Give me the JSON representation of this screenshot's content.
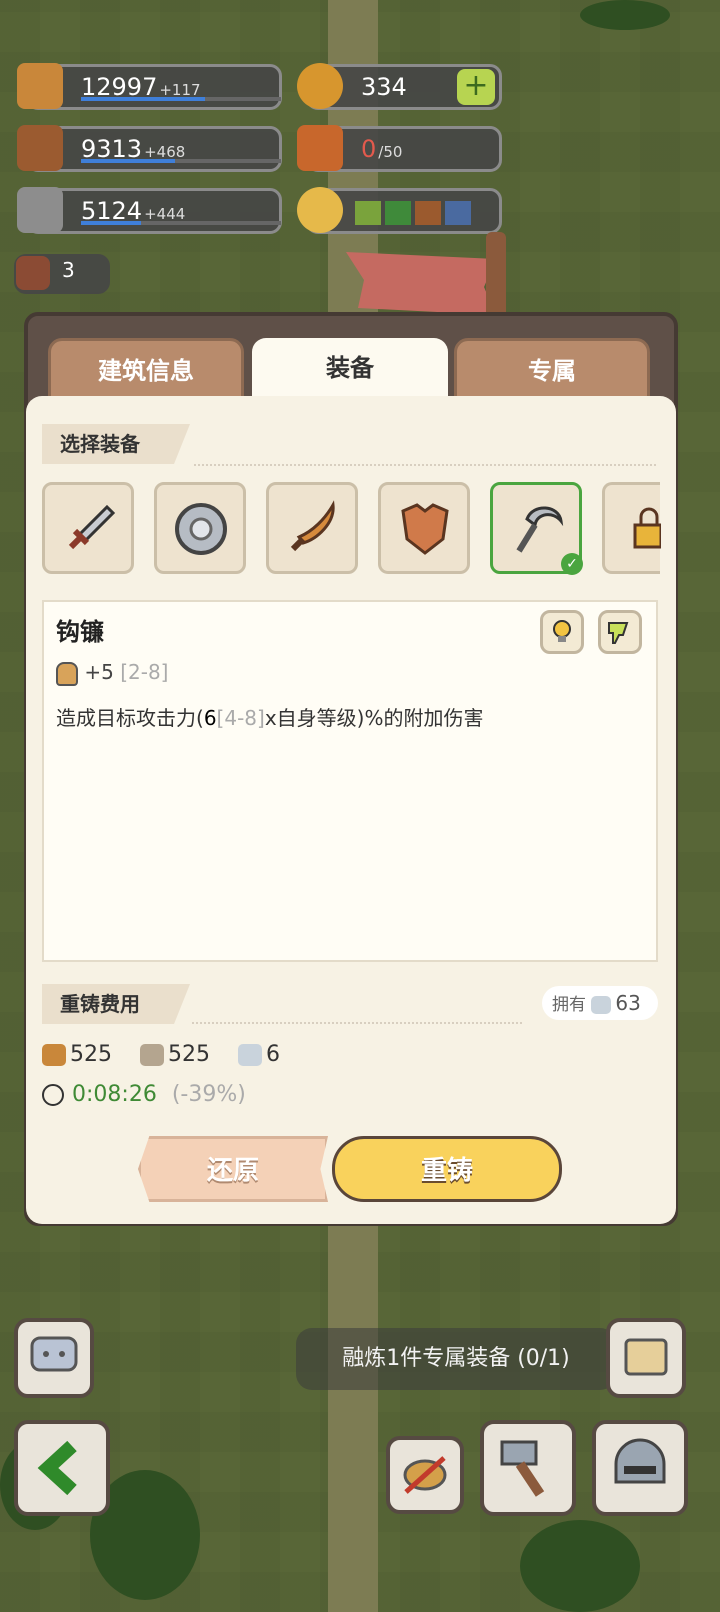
{
  "resources": [
    {
      "icon": "wheat-icon",
      "value": "12997",
      "increment": "+117",
      "bar": 0.62
    },
    {
      "icon": "wood-icon",
      "value": "9313",
      "increment": "+468",
      "bar": 0.47
    },
    {
      "icon": "stone-icon",
      "value": "5124",
      "increment": "+444",
      "bar": 0.3
    }
  ],
  "coins": {
    "value": "334"
  },
  "gifts": {
    "current": "0",
    "max": "/50"
  },
  "book_count": "3",
  "weather_colors": [
    "#7aa33c",
    "#3f8a3a",
    "#9b5a2e",
    "#4a6aa0"
  ],
  "tabs": [
    {
      "label": "建筑信息",
      "active": false
    },
    {
      "label": "装备",
      "active": true
    },
    {
      "label": "专属",
      "active": false
    }
  ],
  "select_title": "选择装备",
  "equipment_slots": [
    {
      "icon": "sword-icon",
      "selected": false
    },
    {
      "icon": "round-shield-icon",
      "selected": false
    },
    {
      "icon": "scimitar-icon",
      "selected": false
    },
    {
      "icon": "armor-icon",
      "selected": false
    },
    {
      "icon": "sickle-icon",
      "selected": true
    },
    {
      "icon": "lock-icon",
      "selected": false
    }
  ],
  "equipment": {
    "name": "钩镰",
    "stat_value": "+5",
    "stat_range": "[2-8]",
    "desc_prefix": "造成目标攻击力(",
    "desc_value": "6",
    "desc_range": "[4-8]",
    "desc_suffix": "x自身等级)%的附加伤害"
  },
  "recast_title": "重铸费用",
  "owned": {
    "label": "拥有",
    "value": "63"
  },
  "costs": {
    "wood": "525",
    "stone": "525",
    "crystal": "6"
  },
  "time": {
    "value": "0:08:26",
    "discount": "(-39%)"
  },
  "buttons": {
    "reset": "还原",
    "recast": "重铸"
  },
  "toast": "融炼1件专属装备 (0/1)"
}
